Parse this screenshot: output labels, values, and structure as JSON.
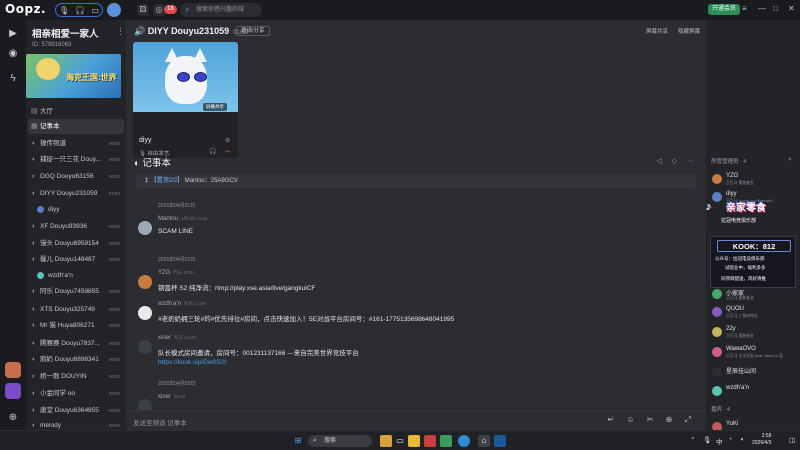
{
  "topbar": {
    "logo": "Oopz.",
    "search_placeholder": "搜索你感兴趣的域",
    "notif_count": "18",
    "vip_label": "开通会员"
  },
  "server": {
    "title": "相亲相爱一家人",
    "id": "ID: 579816063",
    "banner_text": "海克王国:世界"
  },
  "channels": [
    {
      "icon": "📢",
      "label": "大厅",
      "count": ""
    },
    {
      "icon": "📝",
      "label": "记事本",
      "count": ""
    },
    {
      "icon": "🔊",
      "label": "操传频道",
      "count": "00/50"
    },
    {
      "icon": "🔊",
      "label": "捕捉一只三花 Douy...",
      "count": "00/50"
    },
    {
      "icon": "🔊",
      "label": "DGQ Douyu63156",
      "count": "00/50"
    },
    {
      "icon": "🔊",
      "label": "DIYY Douyu231059",
      "count": "01/50"
    },
    {
      "icon": "",
      "label": "diyy",
      "count": ""
    },
    {
      "icon": "🔊",
      "label": "XF Douyu93936",
      "count": "00/50"
    },
    {
      "icon": "🔊",
      "label": "馒头 Douyu6959154",
      "count": "00/50"
    },
    {
      "icon": "🔊",
      "label": "馨儿 Douyu148487",
      "count": "00/50"
    },
    {
      "icon": "",
      "label": "wzdh'a'n",
      "count": ""
    },
    {
      "icon": "🔊",
      "label": "阿乐 Douyu7459855",
      "count": "00/50"
    },
    {
      "icon": "🔊",
      "label": "XTS Douyu325749",
      "count": "00/50"
    },
    {
      "icon": "🔊",
      "label": "Mr 猫 Huya806271",
      "count": "00/50"
    },
    {
      "icon": "🔊",
      "label": "腾赛赛 Douyu7837...",
      "count": "00/50"
    },
    {
      "icon": "🔊",
      "label": "鸦奶 Douyu6898341",
      "count": "00/50"
    },
    {
      "icon": "🔊",
      "label": "桥一歌 DOUYIN",
      "count": "00/50"
    },
    {
      "icon": "🔊",
      "label": "小金同学 oo",
      "count": "00/50"
    },
    {
      "icon": "🔊",
      "label": "唐堂 Douyu6364855",
      "count": "00/50"
    },
    {
      "icon": "🔊",
      "label": "melody",
      "count": "00/50"
    }
  ],
  "main": {
    "channel_title": "DIYY Douyu231059",
    "channel_count": "01/50",
    "invite_label": "邀请/分享",
    "screen_share_btn": "屏幕共享",
    "hide_stream_btn": "隐藏屏幕",
    "video_badge": "屏幕共享",
    "video_user": "diyy",
    "video_action": "自由发言",
    "notes_title": "记事本",
    "pinned_tag": "【置顶2/2】",
    "pinned_text": "Mantou：25A9GCV",
    "composer_placeholder": "发送至频道 记事本"
  },
  "messages": [
    {
      "date": "2026年04月01日"
    },
    {
      "user": "Mantou",
      "time": "4月1日 21:52",
      "text": "SCAM LINE",
      "link": ""
    },
    {
      "date": "2026年04月02日"
    },
    {
      "user": "YZG",
      "time": "昨天 20:51",
      "text": "钢盔杯 S2 纯净流：rtmp://play.xse.asia/live/gangkuiCF",
      "link": ""
    },
    {
      "user": "wzdh'a'n",
      "time": "昨天 21:59",
      "text": "#老奶奶拥三轮#的#优先排位#房间，点击快速加入！5E对战平台房间号：#161-1775135698648041995",
      "link": ""
    },
    {
      "user": "xiner",
      "time": "昨天 23:26",
      "text": "队长模式房间邀请，房间号：001231137166 ---来自完美世界竞技平台",
      "link": "https://kook.vip/Dw0S2I"
    },
    {
      "date": "2026年04月03日"
    },
    {
      "user": "xiner",
      "time": "00:56",
      "text": "",
      "link": ""
    }
  ],
  "members": {
    "header": "房管管理员 · 4",
    "list": [
      {
        "name": "YZG",
        "sub": "正巨马 擅独者会",
        "color": "#c97a3d"
      },
      {
        "name": "diyy",
        "sub": "正巨马 Young And Beautiful",
        "color": "#5b7fc4"
      },
      {
        "name": "小家家",
        "sub": "正巨马 擅独者会",
        "color": "#4aa86a"
      },
      {
        "name": "QUOU",
        "sub": "正巨马 三角洲特战",
        "color": "#8a5bc4"
      },
      {
        "name": "22y",
        "sub": "正巨马 擅独者会",
        "color": "#c4b45b"
      },
      {
        "name": "WawaOVO",
        "sub": "正巨马 天生无丽 (feat. Miss Ko 葛...",
        "color": "#d45d8c"
      },
      {
        "name": "星辰挂山间",
        "sub": "",
        "color": "#2c2d31"
      },
      {
        "name": "wzdh'a'n",
        "sub": "",
        "color": "#5bc4b2"
      },
      {
        "name": "YuKi",
        "sub": "",
        "color": "#c45b5b"
      }
    ],
    "section2": "嘉宾 · 4",
    "promo_title": "亲家零食",
    "promo_sub": "拉冠电竞俱乐部",
    "promo_kook": "KOOK：812",
    "promo_line1": "公众号：拉冠电竞俱乐部",
    "promo_line2": "试验业中，福利多多",
    "promo_line3": "同项目配送，风好清推"
  },
  "taskbar": {
    "search": "搜索",
    "lang": "中",
    "time": "2:58",
    "date": "2026/4/3"
  }
}
